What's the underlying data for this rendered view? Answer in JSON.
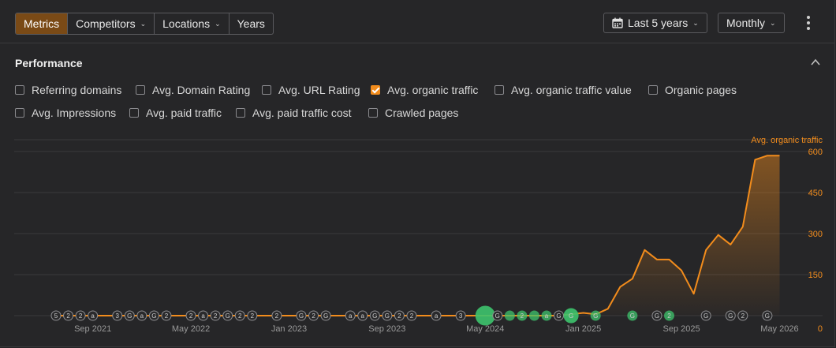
{
  "toolbar": {
    "tabs": [
      {
        "label": "Metrics",
        "active": true,
        "dropdown": false
      },
      {
        "label": "Competitors",
        "active": false,
        "dropdown": true
      },
      {
        "label": "Locations",
        "active": false,
        "dropdown": true
      },
      {
        "label": "Years",
        "active": false,
        "dropdown": false
      }
    ],
    "date_range": "Last 5 years",
    "interval": "Monthly"
  },
  "performance": {
    "title": "Performance",
    "metrics": [
      {
        "label": "Referring domains",
        "checked": false
      },
      {
        "label": "Avg. Domain Rating",
        "checked": false
      },
      {
        "label": "Avg. URL Rating",
        "checked": false
      },
      {
        "label": "Avg. organic traffic",
        "checked": true
      },
      {
        "label": "Avg. organic traffic value",
        "checked": false
      },
      {
        "label": "Organic pages",
        "checked": false
      },
      {
        "label": "Avg. Impressions",
        "checked": false
      },
      {
        "label": "Avg. paid traffic",
        "checked": false
      },
      {
        "label": "Avg. paid traffic cost",
        "checked": false
      },
      {
        "label": "Crawled pages",
        "checked": false
      }
    ]
  },
  "colors": {
    "accent": "#f28c1c",
    "active_tab": "#7a4a16",
    "annotation_green": "#3ec46d"
  },
  "chart_data": {
    "type": "area",
    "series": [
      {
        "name": "Avg. organic traffic",
        "x": [
          "2021-06",
          "2021-07",
          "2021-08",
          "2021-09",
          "2021-10",
          "2021-11",
          "2021-12",
          "2022-01",
          "2022-02",
          "2022-03",
          "2022-04",
          "2022-05",
          "2022-06",
          "2022-07",
          "2022-08",
          "2022-09",
          "2022-10",
          "2022-11",
          "2022-12",
          "2023-01",
          "2023-02",
          "2023-03",
          "2023-04",
          "2023-05",
          "2023-06",
          "2023-07",
          "2023-08",
          "2023-09",
          "2023-10",
          "2023-11",
          "2023-12",
          "2024-01",
          "2024-02",
          "2024-03",
          "2024-04",
          "2024-05",
          "2024-06",
          "2024-07",
          "2024-08",
          "2024-09",
          "2024-10",
          "2024-11",
          "2024-12",
          "2025-01",
          "2025-02",
          "2025-03",
          "2025-04",
          "2025-05",
          "2025-06",
          "2025-07",
          "2025-08",
          "2025-09",
          "2025-10",
          "2025-11",
          "2025-12",
          "2026-01",
          "2026-02",
          "2026-03",
          "2026-04",
          "2026-05"
        ],
        "values": [
          0,
          0,
          0,
          0,
          0,
          0,
          0,
          0,
          0,
          0,
          0,
          0,
          0,
          0,
          0,
          0,
          0,
          0,
          0,
          0,
          0,
          0,
          0,
          0,
          0,
          0,
          0,
          0,
          0,
          0,
          0,
          0,
          0,
          0,
          0,
          0,
          0,
          0,
          0,
          0,
          0,
          0,
          5,
          10,
          5,
          25,
          105,
          135,
          240,
          205,
          205,
          165,
          80,
          240,
          295,
          260,
          325,
          570,
          585,
          585
        ]
      }
    ],
    "x_tick_labels": [
      "Sep 2021",
      "May 2022",
      "Jan 2023",
      "Sep 2023",
      "May 2024",
      "Jan 2025",
      "Sep 2025",
      "May 2026"
    ],
    "y_tick_labels": [
      "0",
      "150",
      "300",
      "450",
      "600"
    ],
    "ylim": [
      0,
      660
    ],
    "legend": "Avg. organic traffic",
    "legend_position": "top-right",
    "grid": true,
    "annotations": [
      {
        "label": "5",
        "date": "2021-06",
        "green": false,
        "size": "s"
      },
      {
        "label": "2",
        "date": "2021-07",
        "green": false,
        "size": "s"
      },
      {
        "label": "2",
        "date": "2021-08",
        "green": false,
        "size": "s"
      },
      {
        "label": "a",
        "date": "2021-09",
        "green": false,
        "size": "s"
      },
      {
        "label": "3",
        "date": "2021-11",
        "green": false,
        "size": "s"
      },
      {
        "label": "G",
        "date": "2021-12",
        "green": false,
        "size": "s"
      },
      {
        "label": "a",
        "date": "2022-01",
        "green": false,
        "size": "s"
      },
      {
        "label": "G",
        "date": "2022-02",
        "green": false,
        "size": "s"
      },
      {
        "label": "2",
        "date": "2022-03",
        "green": false,
        "size": "s"
      },
      {
        "label": "2",
        "date": "2022-05",
        "green": false,
        "size": "s"
      },
      {
        "label": "a",
        "date": "2022-06",
        "green": false,
        "size": "s"
      },
      {
        "label": "2",
        "date": "2022-07",
        "green": false,
        "size": "s"
      },
      {
        "label": "G",
        "date": "2022-08",
        "green": false,
        "size": "s"
      },
      {
        "label": "2",
        "date": "2022-09",
        "green": false,
        "size": "s"
      },
      {
        "label": "2",
        "date": "2022-10",
        "green": false,
        "size": "s"
      },
      {
        "label": "2",
        "date": "2022-12",
        "green": false,
        "size": "s"
      },
      {
        "label": "G",
        "date": "2023-02",
        "green": false,
        "size": "s"
      },
      {
        "label": "2",
        "date": "2023-03",
        "green": false,
        "size": "s"
      },
      {
        "label": "G",
        "date": "2023-04",
        "green": false,
        "size": "s"
      },
      {
        "label": "a",
        "date": "2023-06",
        "green": false,
        "size": "s"
      },
      {
        "label": "a",
        "date": "2023-07",
        "green": false,
        "size": "s"
      },
      {
        "label": "G",
        "date": "2023-08",
        "green": false,
        "size": "s"
      },
      {
        "label": "G",
        "date": "2023-09",
        "green": false,
        "size": "s"
      },
      {
        "label": "2",
        "date": "2023-10",
        "green": false,
        "size": "s"
      },
      {
        "label": "2",
        "date": "2023-11",
        "green": false,
        "size": "s"
      },
      {
        "label": "a",
        "date": "2024-01",
        "green": false,
        "size": "s"
      },
      {
        "label": "3",
        "date": "2024-03",
        "green": false,
        "size": "s"
      },
      {
        "label": "",
        "date": "2024-05",
        "green": true,
        "size": "l"
      },
      {
        "label": "G",
        "date": "2024-06",
        "green": false,
        "size": "s"
      },
      {
        "label": "",
        "date": "2024-07",
        "green": true,
        "size": "s"
      },
      {
        "label": "2",
        "date": "2024-08",
        "green": true,
        "size": "s"
      },
      {
        "label": "",
        "date": "2024-09",
        "green": true,
        "size": "s"
      },
      {
        "label": "a",
        "date": "2024-10",
        "green": true,
        "size": "s"
      },
      {
        "label": "G",
        "date": "2024-11",
        "green": false,
        "size": "s"
      },
      {
        "label": "G",
        "date": "2024-12",
        "green": true,
        "size": "m"
      },
      {
        "label": "G",
        "date": "2025-02",
        "green": true,
        "size": "s"
      },
      {
        "label": "G",
        "date": "2025-05",
        "green": true,
        "size": "s"
      },
      {
        "label": "G",
        "date": "2025-07",
        "green": false,
        "size": "s"
      },
      {
        "label": "2",
        "date": "2025-08",
        "green": true,
        "size": "s"
      },
      {
        "label": "G",
        "date": "2025-11",
        "green": false,
        "size": "s"
      },
      {
        "label": "G",
        "date": "2026-01",
        "green": false,
        "size": "s"
      },
      {
        "label": "2",
        "date": "2026-02",
        "green": false,
        "size": "s"
      },
      {
        "label": "G",
        "date": "2026-04",
        "green": false,
        "size": "s"
      }
    ]
  }
}
